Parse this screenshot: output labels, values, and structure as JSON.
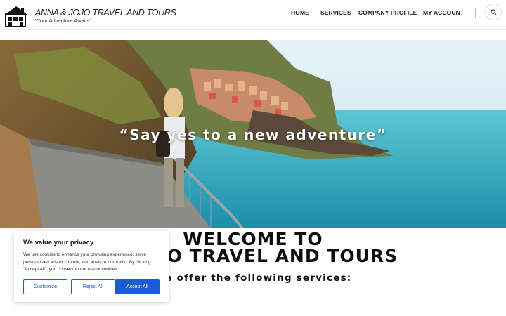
{
  "header": {
    "brand_title": "ANNA & JOJO TRAVEL AND TOURS",
    "tagline": "\"Your Adventure Awaits\"",
    "nav": [
      {
        "label": "HOME"
      },
      {
        "label": "SERVICES"
      },
      {
        "label": "COMPANY PROFILE"
      },
      {
        "label": "MY ACCOUNT"
      }
    ],
    "logo_icon": "house-icon",
    "search_icon": "search-icon"
  },
  "hero": {
    "quote": "“Say yes to a new adventure”"
  },
  "welcome": {
    "line1": "WELCOME TO",
    "line2": "ANNA & JOJO TRAVEL AND TOURS",
    "services_intro": "We offer the following services:"
  },
  "cookie_banner": {
    "title": "We value your privacy",
    "text": "We use cookies to enhance your browsing experience, serve personalized ads or content, and analyze our traffic. By clicking \"Accept All\", you consent to our use of cookies.",
    "customize_label": "Customize",
    "reject_label": "Reject All",
    "accept_label": "Accept All"
  },
  "colors": {
    "accent": "#1a5bd6",
    "sea": "#2bb3c8",
    "sky": "#cfe6f2"
  }
}
